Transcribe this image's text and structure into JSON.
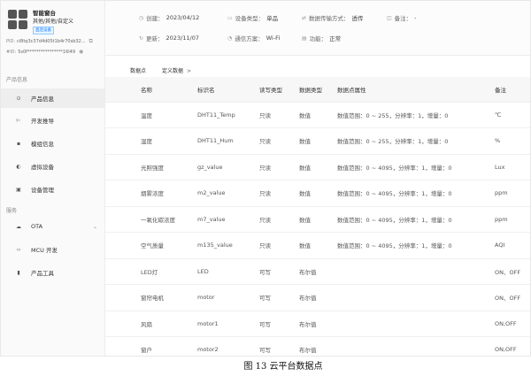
{
  "sidebar": {
    "brand_name": "智能窗台",
    "brand_type": "其他/其他/自定义",
    "brand_badge": "直连设备",
    "meta": [
      {
        "label": "PID:",
        "value": "cl8tq3c37d4d05t1b4r70sb32..."
      },
      {
        "label": "#ID:",
        "value": "5s0f****************16l49"
      }
    ],
    "section_product": "产品信息",
    "section_service": "服务",
    "items_product": [
      {
        "label": "产品信息",
        "icon": "info-icon",
        "glyph": "⊙"
      },
      {
        "label": "开发推导",
        "icon": "code-icon",
        "glyph": "⊢"
      },
      {
        "label": "模组信息",
        "icon": "module-icon",
        "glyph": "▪"
      },
      {
        "label": "虚拟设备",
        "icon": "virtual-device-icon",
        "glyph": "◐"
      },
      {
        "label": "设备管理",
        "icon": "device-icon",
        "glyph": "▣"
      }
    ],
    "items_service": [
      {
        "label": "OTA",
        "icon": "ota-icon",
        "glyph": "☁"
      },
      {
        "label": "MCU 开发",
        "icon": "mcu-icon",
        "glyph": "‹›"
      },
      {
        "label": "产品工具",
        "icon": "tool-icon",
        "glyph": "▮"
      }
    ]
  },
  "info": {
    "created_label": "创建：",
    "created_value": "2023/04/12",
    "device_type_label": "设备类型：",
    "device_type_value": "单品",
    "transfer_label": "数据传输方式：",
    "transfer_value": "透传",
    "note_label": "备注：",
    "note_value": "-",
    "updated_label": "更新：",
    "updated_value": "2023/11/07",
    "comm_label": "通信方案：",
    "comm_value": "Wi-Fi",
    "func_label": "功能：",
    "func_value": "正常"
  },
  "tabs": {
    "datapoints": "数据点",
    "custom": "定义数据",
    "chevron": ">"
  },
  "table": {
    "headers": [
      "名称",
      "标识名",
      "读写类型",
      "数据类型",
      "数据点属性",
      "备注"
    ],
    "rows": [
      [
        "温度",
        "DHT11_Temp",
        "只读",
        "数值",
        "数值范围：0 ~ 255，分辨率：1，增量：0",
        "℃"
      ],
      [
        "湿度",
        "DHT11_Hum",
        "只读",
        "数值",
        "数值范围：0 ~ 255，分辨率：1，增量：0",
        "%"
      ],
      [
        "光照强度",
        "gz_value",
        "只读",
        "数值",
        "数值范围：0 ~ 4095，分辨率：1，增量：0",
        "Lux"
      ],
      [
        "烟雾浓度",
        "m2_value",
        "只读",
        "数值",
        "数值范围：0 ~ 4095，分辨率：1，增量：0",
        "ppm"
      ],
      [
        "一氧化碳浓度",
        "m7_value",
        "只读",
        "数值",
        "数值范围：0 ~ 4095，分辨率：1，增量：0",
        "ppm"
      ],
      [
        "空气质量",
        "m135_value",
        "只读",
        "数值",
        "数值范围：0 ~ 4095，分辨率：1，增量：0",
        "AQI"
      ],
      [
        "LED灯",
        "LED",
        "可写",
        "布尔值",
        "",
        "ON、OFF"
      ],
      [
        "窗帘电机",
        "motor",
        "可写",
        "布尔值",
        "",
        "ON、OFF"
      ],
      [
        "风扇",
        "motor1",
        "可写",
        "布尔值",
        "",
        "ON,OFF"
      ],
      [
        "窗户",
        "motor2",
        "可写",
        "布尔值",
        "",
        "ON,OFF"
      ]
    ]
  },
  "caption": "图 13    云平台数据点"
}
